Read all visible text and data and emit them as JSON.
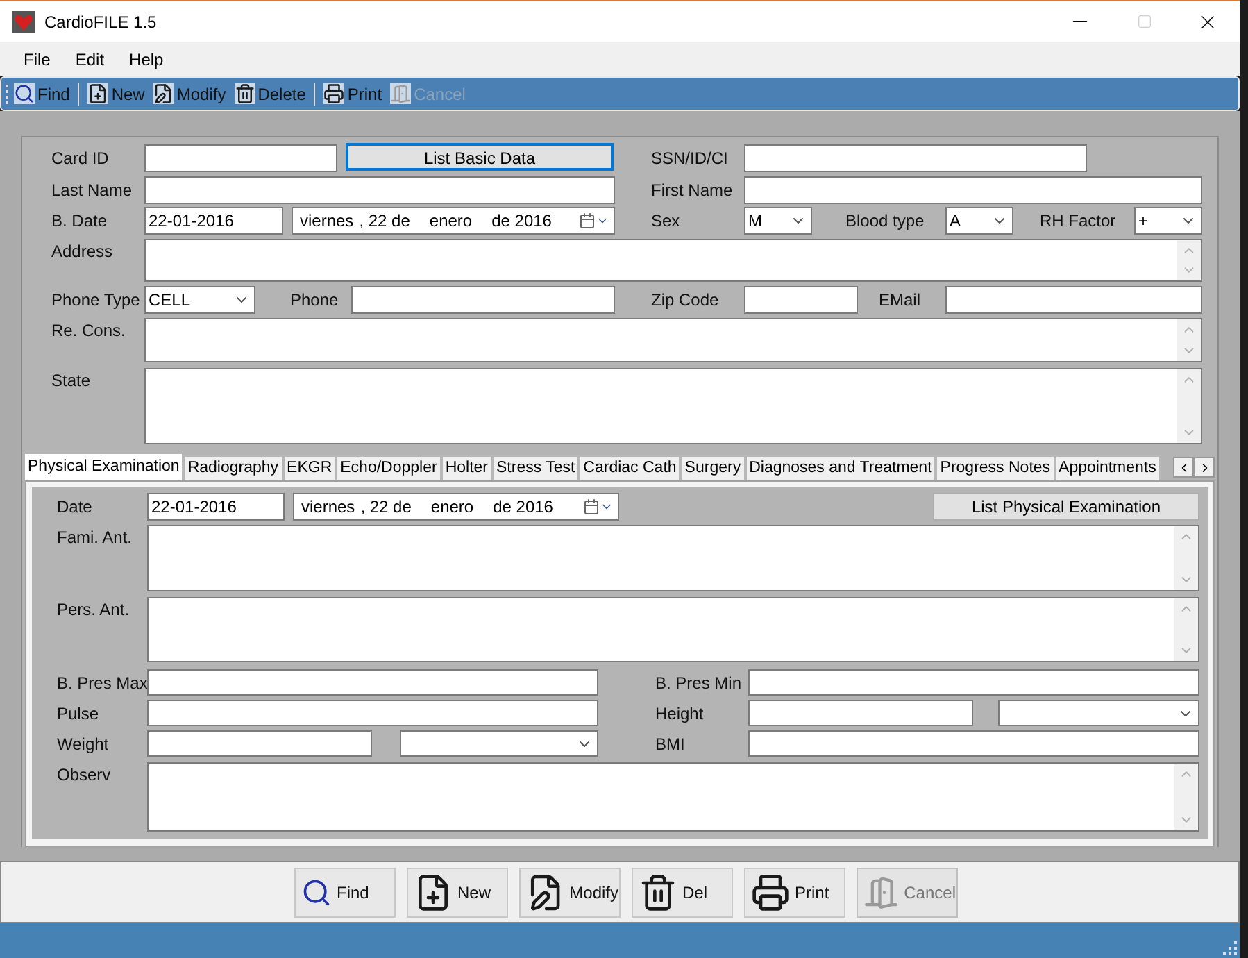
{
  "window": {
    "title": "CardioFILE 1.5"
  },
  "menu": [
    "File",
    "Edit",
    "Help"
  ],
  "toolbar": [
    {
      "label": "Find",
      "disabled": false
    },
    {
      "label": "New",
      "disabled": false
    },
    {
      "label": "Modify",
      "disabled": false
    },
    {
      "label": "Delete",
      "disabled": false
    },
    {
      "label": "Print",
      "disabled": false
    },
    {
      "label": "Cancel",
      "disabled": true
    }
  ],
  "basic_data": {
    "card_id_label": "Card ID",
    "list_button": {
      "label": "List Basic Data",
      "focused": true
    },
    "ssn_label": "SSN/ID/CI",
    "last_name_label": "Last Name",
    "first_name_label": "First Name",
    "birth_date": {
      "label": "B. Date",
      "value": "22-01-2016",
      "long_date": [
        "viernes",
        ", 22 de",
        "enero",
        "de 2016"
      ]
    },
    "sex": {
      "label": "Sex",
      "value": "M"
    },
    "blood_type": {
      "label": "Blood type",
      "value": "A"
    },
    "rh_factor": {
      "label": "RH Factor",
      "value": "+"
    },
    "address_label": "Address",
    "phone_type": {
      "label": "Phone Type",
      "value": "CELL"
    },
    "phone_label": "Phone",
    "zip_label": "Zip Code",
    "email_label": "EMail",
    "re_cons_label": "Re. Cons.",
    "state_label": "State"
  },
  "tabs": [
    {
      "label": "Physical Examination",
      "selected": true
    },
    {
      "label": "Radiography",
      "selected": false
    },
    {
      "label": "EKGR",
      "selected": false
    },
    {
      "label": "Echo/Doppler",
      "selected": false
    },
    {
      "label": "Holter",
      "selected": false
    },
    {
      "label": "Stress Test",
      "selected": false
    },
    {
      "label": "Cardiac Cath",
      "selected": false
    },
    {
      "label": "Surgery",
      "selected": false
    },
    {
      "label": "Diagnoses and Treatment",
      "selected": false
    },
    {
      "label": "Progress Notes",
      "selected": false
    },
    {
      "label": "Appointments",
      "selected": false
    }
  ],
  "physical_exam": {
    "date": {
      "label": "Date",
      "value": "22-01-2016",
      "long_date": [
        "viernes",
        ", 22 de",
        "enero",
        "de 2016"
      ]
    },
    "list_button": {
      "label": "List Physical Examination",
      "focused": false
    },
    "fami_ant_label": "Fami. Ant.",
    "pers_ant_label": "Pers. Ant.",
    "bp_max_label": "B. Pres Max",
    "bp_min_label": "B. Pres Min",
    "pulse_label": "Pulse",
    "height_label": "Height",
    "weight_label": "Weight",
    "bmi_label": "BMI",
    "observ_label": "Observ"
  },
  "bottom_buttons": [
    {
      "label": "Find",
      "disabled": false
    },
    {
      "label": "New",
      "disabled": false
    },
    {
      "label": "Modify",
      "disabled": false
    },
    {
      "label": "Del",
      "disabled": false
    },
    {
      "label": "Print",
      "disabled": false
    },
    {
      "label": "Cancel",
      "disabled": true
    }
  ]
}
